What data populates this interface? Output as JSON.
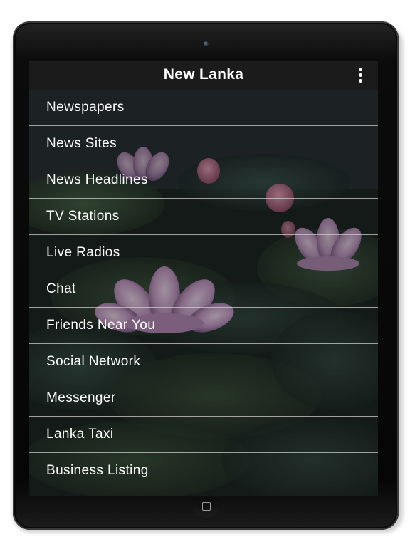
{
  "app": {
    "title": "New Lanka"
  },
  "menu": {
    "items": [
      {
        "label": "Newspapers"
      },
      {
        "label": "News Sites"
      },
      {
        "label": "News Headlines"
      },
      {
        "label": "TV Stations"
      },
      {
        "label": "Live Radios"
      },
      {
        "label": "Chat"
      },
      {
        "label": "Friends Near You"
      },
      {
        "label": "Social Network"
      },
      {
        "label": "Messenger"
      },
      {
        "label": "Lanka Taxi"
      },
      {
        "label": "Business Listing"
      }
    ]
  },
  "icons": {
    "overflow": "more-vertical-icon",
    "home": "home-button-icon",
    "camera": "front-camera-icon"
  },
  "colors": {
    "app_bar": "#1b1b1b",
    "text": "#ffffff",
    "divider": "#cdcdcd",
    "device_frame": "#0b0b0b"
  }
}
